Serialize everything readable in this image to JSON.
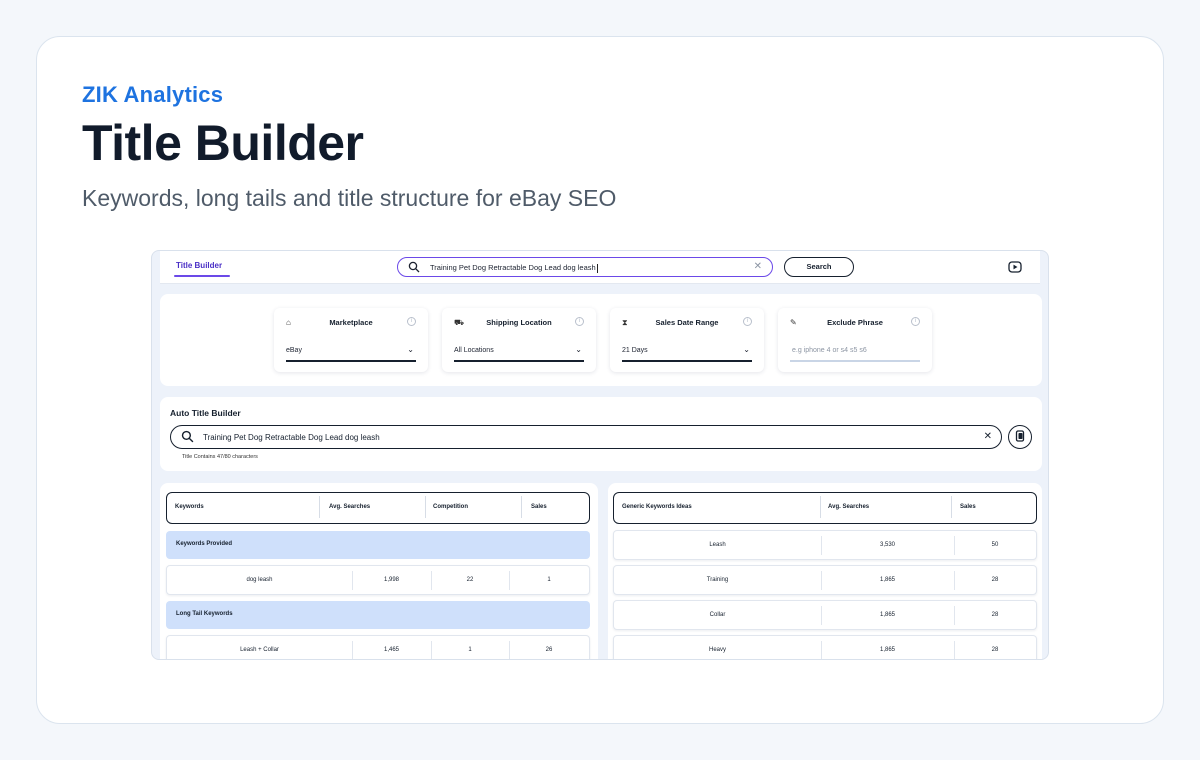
{
  "brand": "ZIK Analytics",
  "title": "Title Builder",
  "subtitle": "Keywords, long tails and title structure for eBay SEO",
  "app": {
    "tab_label": "Title Builder",
    "search_value": "Training Pet Dog Retractable Dog Lead dog leash",
    "search_button": "Search",
    "filters": [
      {
        "label": "Marketplace",
        "value": "eBay",
        "icon": "store-icon"
      },
      {
        "label": "Shipping Location",
        "value": "All Locations",
        "icon": "truck-icon"
      },
      {
        "label": "Sales Date Range",
        "value": "21 Days",
        "icon": "hourglass-icon"
      },
      {
        "label": "Exclude Phrase",
        "placeholder": "e.g iphone 4 or s4 s5 s6",
        "icon": "pencil-icon"
      }
    ],
    "auto_title": {
      "heading": "Auto Title Builder",
      "value": "Training Pet Dog Retractable Dog Lead dog leash",
      "note": "Title Contains 47/80 characters"
    },
    "left_table": {
      "headers": [
        "Keywords",
        "Avg. Searches",
        "Competition",
        "Sales"
      ],
      "group1": "Keywords Provided",
      "row1": [
        "dog leash",
        "1,998",
        "22",
        "1"
      ],
      "group2": "Long Tail Keywords",
      "row2": [
        "Leash + Collar",
        "1,465",
        "1",
        "26"
      ]
    },
    "right_table": {
      "headers": [
        "Generic Keywords Ideas",
        "Avg. Searches",
        "Sales"
      ],
      "rows": [
        [
          "Leash",
          "3,530",
          "50"
        ],
        [
          "Training",
          "1,865",
          "28"
        ],
        [
          "Collar",
          "1,865",
          "28"
        ],
        [
          "Heavy",
          "1,865",
          "28"
        ]
      ]
    }
  },
  "colors": {
    "brand_blue": "#1e73e0",
    "accent_purple": "#6b49e8",
    "group_bg": "#cfe0fb"
  }
}
